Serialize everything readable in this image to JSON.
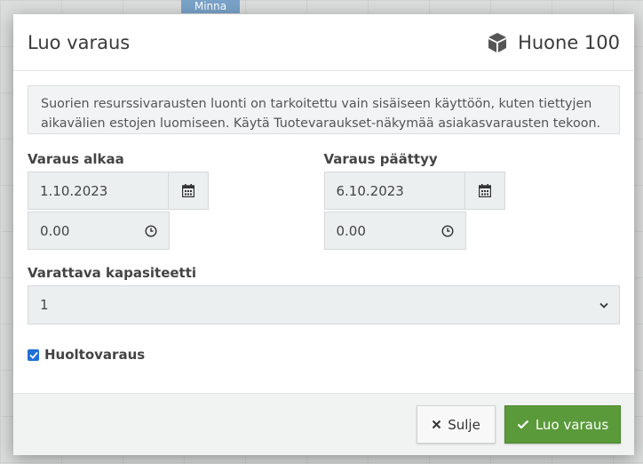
{
  "background": {
    "event_label": "Minna"
  },
  "modal": {
    "title": "Luo varaus",
    "room_name": "Huone 100",
    "info_text": "Suorien resurssivarausten luonti on tarkoitettu vain sisäiseen käyttöön, kuten tiettyjen aikavälien estojen luomiseen. Käytä Tuotevaraukset-näkymää asiakasvarausten tekoon.",
    "start": {
      "label": "Varaus alkaa",
      "date": "1.10.2023",
      "time": "0.00"
    },
    "end": {
      "label": "Varaus päättyy",
      "date": "6.10.2023",
      "time": "0.00"
    },
    "capacity": {
      "label": "Varattava kapasiteetti",
      "selected": "1"
    },
    "maintenance": {
      "label": "Huoltovaraus",
      "checked": true
    },
    "footer": {
      "close_label": "Sulje",
      "create_label": "Luo varaus"
    }
  },
  "colors": {
    "primary_button": "#5a9a3a",
    "checkbox": "#1f6fd6",
    "background_event": "#7aa3c9"
  },
  "icons": {
    "room": "cube-icon",
    "date": "calendar-icon",
    "time": "clock-icon",
    "select": "chevron-down-icon",
    "close": "close-icon",
    "create": "checkmark-icon"
  }
}
